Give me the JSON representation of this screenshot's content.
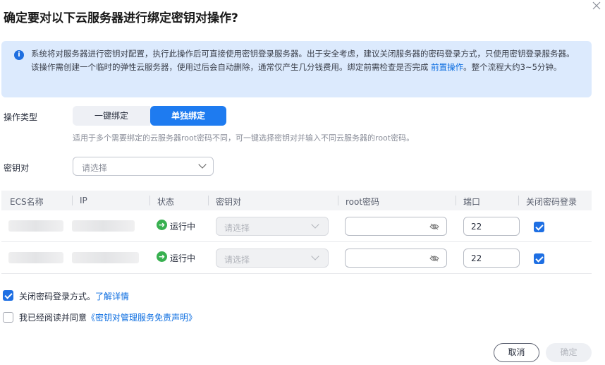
{
  "dialog": {
    "title": "确定要对以下云服务器进行绑定密钥对操作?"
  },
  "info": {
    "text_main": "系统将对服务器进行密钥对配置，执行此操作后可直接使用密钥登录服务器。出于安全考虑，建议关闭服务器的密码登录方式，只使用密钥登录服务器。该操作需创建一个临时的弹性云服务器，使用过后会自动删除，通常仅产生几分钱费用。绑定前需检查是否完成 ",
    "link": "前置操作",
    "text_tail": "。整个流程大约3~5分钟。"
  },
  "operation_type": {
    "label": "操作类型",
    "options": [
      "一键绑定",
      "单独绑定"
    ],
    "selected": "单独绑定",
    "hint": "适用于多个需要绑定的云服务器root密码不同，可一键选择密钥对并输入不同云服务器的root密码。"
  },
  "keypair": {
    "label": "密钥对",
    "placeholder": "请选择"
  },
  "table": {
    "headers": [
      "ECS名称",
      "IP",
      "状态",
      "密钥对",
      "root密码",
      "端口",
      "关闭密码登录"
    ],
    "rows": [
      {
        "status": "运行中",
        "keypair_placeholder": "请选择",
        "port": "22",
        "close_pwd_login": true
      },
      {
        "status": "运行中",
        "keypair_placeholder": "请选择",
        "port": "22",
        "close_pwd_login": true
      }
    ]
  },
  "options": {
    "close_pwd_label": "关闭密码登录方式。",
    "close_pwd_link": "了解详情",
    "close_pwd_checked": true,
    "agree_label": "我已经阅读并同意",
    "agree_link": "《密钥对管理服务免责声明》",
    "agree_checked": false
  },
  "footer": {
    "cancel": "取消",
    "confirm": "确定"
  },
  "colors": {
    "accent": "#1e7bf0",
    "info_bg": "#dceafd",
    "running": "#38b050"
  }
}
